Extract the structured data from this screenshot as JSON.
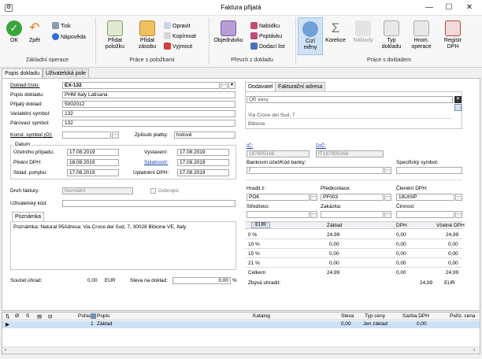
{
  "window": {
    "title": "Faktura přijatá",
    "app_icon": "⚙",
    "minimize": "—",
    "maximize": "☐",
    "close": "✕"
  },
  "ribbon": {
    "ok": "OK",
    "back": "Zpět",
    "print": "Tisk",
    "help": "Nápověda",
    "group_basic": "Základní operace",
    "add_item": "Přidat položku",
    "add_stock": "Přidat zásobu",
    "edit": "Opravit",
    "copy": "Kopírovat",
    "cut": "Vyjmout",
    "group_items": "Práce s položkami",
    "order": "Objednávku",
    "offer": "Nabídku",
    "inquiry": "Poptávku",
    "delivery_note": "Dodací list",
    "group_transfer": "Převzít z dokladu",
    "foreign_currency": "Cizí měny",
    "correction": "Korekce",
    "costs": "Náklady",
    "doc_type": "Typ dokladu",
    "bulk_op": "Hrom. operace",
    "vat_reg": "Registr DPH",
    "group_doc": "Práce s dokladem"
  },
  "tabs": [
    "Popis dokladu",
    "Uživatelská pole"
  ],
  "doc": {
    "number_label": "Doklad číslo:",
    "number": "EX-132",
    "desc_label": "Popis dokladu:",
    "desc": "PHM Italy Latisana",
    "received_label": "Přijatý doklad:",
    "received": "5002012",
    "varsym_label": "Variabilní symbol:",
    "varsym": "132",
    "pairsym_label": "Párovací symbol:",
    "pairsym": "132",
    "constsym_label": "Konst. symbol (O):",
    "constsym": "",
    "payment_label": "Způsob platby:",
    "payment": "hotově",
    "dates_title": "Datum",
    "date_case_label": "Účetního případu:",
    "date_case": "17.08.2019",
    "issued_label": "Vystavení:",
    "issued": "17.08.2019",
    "vat_date_label": "Plnění DPH:",
    "vat_date": "18.08.2019",
    "due_label": "Splatnosti:",
    "due": "17.08.2019",
    "stock_label": "Sklad. pohybu:",
    "stock": "17.08.2019",
    "vat_claim_label": "Uplatnění DPH:",
    "vat_claim": "17.08.2019",
    "type_label": "Druh faktury:",
    "type": "Normální",
    "credit_note": "Dobropis",
    "user_code_label": "Uživatelský kód:",
    "user_code": "",
    "note_tab": "Poznámka",
    "note": "Poznámka: Natural 95Adresa: Via Croce del Sud, 7, 30028 Bibione VE, Italy",
    "total_label": "Součet úhrad:",
    "total": "0,00",
    "currency": "EUR",
    "discount_label": "Sleva na doklad:",
    "discount": "0,00",
    "percent": "%"
  },
  "supplier": {
    "tab1": "Dodavatel",
    "tab2": "Fakturační adresa",
    "name": "QB easy",
    "street": "Via Croce del Sud, 7",
    "city": "Bibione",
    "ico_label": "IČ:",
    "ico": "187905168",
    "dic_label": "DIČ:",
    "dic": "IT187905168",
    "bank_label": "Bankovní účet/Kód banky:",
    "bank": "/",
    "specsym_label": "Specifický symbol:",
    "specsym": ""
  },
  "accounting": {
    "pay_from_label": "Hradit z:",
    "pay_from": "POK",
    "precontrol_label": "Předkontace:",
    "precontrol": "PF003",
    "vat_class_label": "Členění DPH:",
    "vat_class": "19Ú00P",
    "center_label": "Středisko:",
    "order_label": "Zakázka:",
    "activity_label": "Činnost:"
  },
  "vat_table": {
    "headers": [
      "EUR",
      "Základ",
      "DPH",
      "Včetně DPH"
    ],
    "rows": [
      [
        "0 %",
        "24,99",
        "0,00",
        "24,99"
      ],
      [
        "10 %",
        "0,00",
        "0,00",
        "0,00"
      ],
      [
        "15 %",
        "0,00",
        "0,00",
        "0,00"
      ],
      [
        "21 %",
        "0,00",
        "0,00",
        "0,00"
      ],
      [
        "Celkem",
        "24,99",
        "0,00",
        "24,99"
      ]
    ],
    "remaining_label": "Zbývá uhradit:",
    "remaining": "24,99",
    "remaining_currency": "EUR"
  },
  "grid": {
    "headers": [
      "Pořadí",
      "Popis",
      "Katalog",
      "Sleva",
      "Typ ceny",
      "Sazba DPH",
      "Pořiz. cena"
    ],
    "icon_headers": [
      "Ø",
      "S",
      "▤",
      "⊟"
    ],
    "rows": [
      [
        "1",
        "Základ",
        "",
        "0,00",
        "Jen základ",
        "0,00",
        ""
      ]
    ]
  }
}
